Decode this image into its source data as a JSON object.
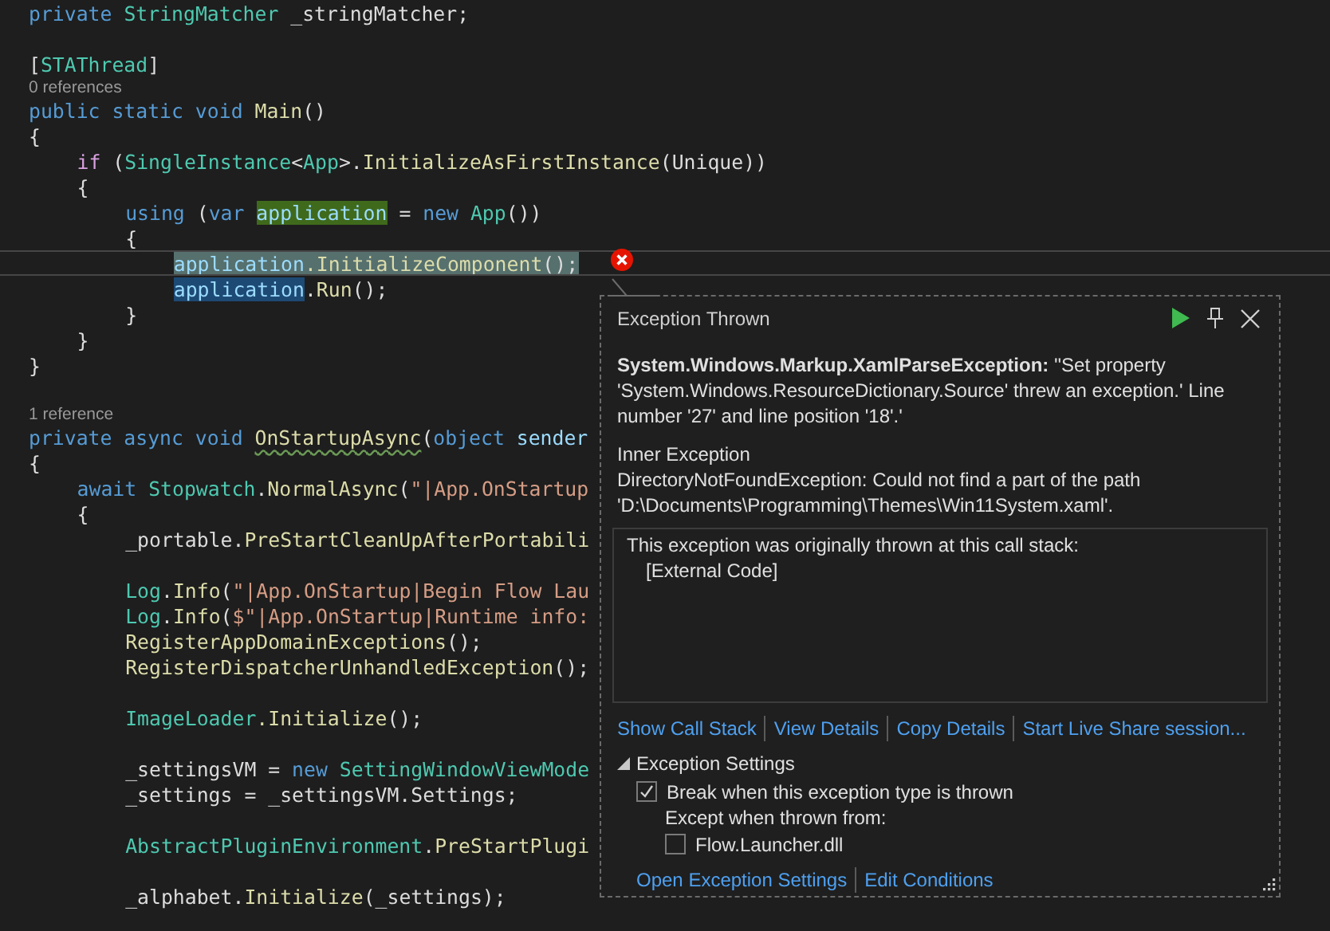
{
  "editor": {
    "lines": [
      {
        "kind": "code",
        "current": false,
        "tokens": [
          {
            "text": "private ",
            "kind": "keyword"
          },
          {
            "text": "StringMatcher",
            "kind": "type"
          },
          {
            "text": " _stringMatcher;",
            "kind": "plain"
          }
        ]
      },
      {
        "kind": "blank"
      },
      {
        "kind": "code",
        "current": false,
        "tokens": [
          {
            "text": "[",
            "kind": "plain"
          },
          {
            "text": "STAThread",
            "kind": "type"
          },
          {
            "text": "]",
            "kind": "plain"
          }
        ]
      },
      {
        "kind": "codelens",
        "text": "0 references"
      },
      {
        "kind": "code",
        "current": false,
        "tokens": [
          {
            "text": "public static void ",
            "kind": "keyword"
          },
          {
            "text": "Main",
            "kind": "method"
          },
          {
            "text": "()",
            "kind": "plain"
          }
        ]
      },
      {
        "kind": "code",
        "current": false,
        "tokens": [
          {
            "text": "{",
            "kind": "plain"
          }
        ]
      },
      {
        "kind": "block",
        "children": [
          {
            "kind": "code",
            "current": false,
            "tokens": [
              {
                "text": "if",
                "kind": "control"
              },
              {
                "text": " (",
                "kind": "plain"
              },
              {
                "text": "SingleInstance",
                "kind": "type"
              },
              {
                "text": "<",
                "kind": "plain"
              },
              {
                "text": "App",
                "kind": "type"
              },
              {
                "text": ">.",
                "kind": "plain"
              },
              {
                "text": "InitializeAsFirstInstance",
                "kind": "method"
              },
              {
                "text": "(Unique))",
                "kind": "plain"
              }
            ]
          },
          {
            "kind": "code",
            "current": false,
            "tokens": [
              {
                "text": "{",
                "kind": "plain"
              }
            ]
          },
          {
            "kind": "block",
            "children": [
              {
                "kind": "code",
                "current": false,
                "tokens": [
                  {
                    "text": "using",
                    "kind": "keyword"
                  },
                  {
                    "text": " (",
                    "kind": "plain"
                  },
                  {
                    "text": "var ",
                    "kind": "keyword"
                  },
                  {
                    "text": "application",
                    "kind": "variable_write"
                  },
                  {
                    "text": " = ",
                    "kind": "plain"
                  },
                  {
                    "text": "new ",
                    "kind": "keyword"
                  },
                  {
                    "text": "App",
                    "kind": "type"
                  },
                  {
                    "text": "())",
                    "kind": "plain"
                  }
                ]
              },
              {
                "kind": "code",
                "current": false,
                "tokens": [
                  {
                    "text": "{",
                    "kind": "plain"
                  }
                ]
              },
              {
                "kind": "block",
                "children": [
                  {
                    "kind": "code",
                    "current": true,
                    "tokens": [
                      {
                        "text": "application",
                        "kind": "variable"
                      },
                      {
                        "text": ".InitializeComponent",
                        "kind": "method"
                      },
                      {
                        "text": "();",
                        "kind": "plain"
                      }
                    ]
                  },
                  {
                    "kind": "code",
                    "current": false,
                    "tokens": [
                      {
                        "text": "application",
                        "kind": "variable_read"
                      },
                      {
                        "text": ".",
                        "kind": "plain"
                      },
                      {
                        "text": "Run",
                        "kind": "method"
                      },
                      {
                        "text": "();",
                        "kind": "plain"
                      }
                    ]
                  }
                ]
              },
              {
                "kind": "code",
                "current": false,
                "tokens": [
                  {
                    "text": "}",
                    "kind": "plain"
                  }
                ]
              }
            ]
          },
          {
            "kind": "code",
            "current": false,
            "tokens": [
              {
                "text": "}",
                "kind": "plain"
              }
            ]
          }
        ]
      },
      {
        "kind": "code",
        "current": false,
        "tokens": [
          {
            "text": "}",
            "kind": "plain"
          }
        ]
      },
      {
        "kind": "blank"
      },
      {
        "kind": "codelens",
        "text": "1 reference"
      },
      {
        "kind": "code",
        "current": false,
        "tokens": [
          {
            "text": "private async void ",
            "kind": "keyword"
          },
          {
            "text": "OnStartupAsync",
            "kind": "method_warning"
          },
          {
            "text": "(",
            "kind": "plain"
          },
          {
            "text": "object ",
            "kind": "keyword"
          },
          {
            "text": "sender",
            "kind": "variable"
          }
        ]
      },
      {
        "kind": "code",
        "current": false,
        "tokens": [
          {
            "text": "{",
            "kind": "plain"
          }
        ]
      },
      {
        "kind": "block",
        "children": [
          {
            "kind": "code",
            "current": false,
            "tokens": [
              {
                "text": "await ",
                "kind": "keyword"
              },
              {
                "text": "Stopwatch",
                "kind": "type"
              },
              {
                "text": ".",
                "kind": "plain"
              },
              {
                "text": "NormalAsync",
                "kind": "method"
              },
              {
                "text": "(",
                "kind": "plain"
              },
              {
                "text": "\"|App.OnStartup",
                "kind": "string"
              }
            ]
          },
          {
            "kind": "code",
            "current": false,
            "tokens": [
              {
                "text": "{",
                "kind": "plain"
              }
            ]
          },
          {
            "kind": "block",
            "children": [
              {
                "kind": "code",
                "current": false,
                "tokens": [
                  {
                    "text": "_portable.",
                    "kind": "plain"
                  },
                  {
                    "text": "PreStartCleanUpAfterPortabili",
                    "kind": "method"
                  }
                ]
              },
              {
                "kind": "blank"
              },
              {
                "kind": "code",
                "current": false,
                "tokens": [
                  {
                    "text": "Log",
                    "kind": "type"
                  },
                  {
                    "text": ".",
                    "kind": "plain"
                  },
                  {
                    "text": "Info",
                    "kind": "method"
                  },
                  {
                    "text": "(",
                    "kind": "plain"
                  },
                  {
                    "text": "\"|App.OnStartup|Begin Flow Lau",
                    "kind": "string"
                  }
                ]
              },
              {
                "kind": "code",
                "current": false,
                "tokens": [
                  {
                    "text": "Log",
                    "kind": "type"
                  },
                  {
                    "text": ".",
                    "kind": "plain"
                  },
                  {
                    "text": "Info",
                    "kind": "method"
                  },
                  {
                    "text": "(",
                    "kind": "plain"
                  },
                  {
                    "text": "$\"|App.OnStartup|Runtime info:",
                    "kind": "string"
                  }
                ]
              },
              {
                "kind": "code",
                "current": false,
                "tokens": [
                  {
                    "text": "RegisterAppDomainExceptions",
                    "kind": "method"
                  },
                  {
                    "text": "();",
                    "kind": "plain"
                  }
                ]
              },
              {
                "kind": "code",
                "current": false,
                "tokens": [
                  {
                    "text": "RegisterDispatcherUnhandledException",
                    "kind": "method"
                  },
                  {
                    "text": "();",
                    "kind": "plain"
                  }
                ]
              },
              {
                "kind": "blank"
              },
              {
                "kind": "code",
                "current": false,
                "tokens": [
                  {
                    "text": "ImageLoader",
                    "kind": "type"
                  },
                  {
                    "text": ".Initialize",
                    "kind": "method"
                  },
                  {
                    "text": "();",
                    "kind": "plain"
                  }
                ]
              },
              {
                "kind": "blank"
              },
              {
                "kind": "code",
                "current": false,
                "tokens": [
                  {
                    "text": "_settingsVM = ",
                    "kind": "plain"
                  },
                  {
                    "text": "new ",
                    "kind": "keyword"
                  },
                  {
                    "text": "SettingWindowViewMode",
                    "kind": "type"
                  }
                ]
              },
              {
                "kind": "code",
                "current": false,
                "tokens": [
                  {
                    "text": "_settings = _settingsVM.Settings;",
                    "kind": "plain"
                  }
                ]
              },
              {
                "kind": "blank"
              },
              {
                "kind": "code",
                "current": false,
                "tokens": [
                  {
                    "text": "AbstractPluginEnvironment",
                    "kind": "type"
                  },
                  {
                    "text": ".",
                    "kind": "plain"
                  },
                  {
                    "text": "PreStartPlugi",
                    "kind": "method"
                  }
                ]
              },
              {
                "kind": "blank"
              },
              {
                "kind": "code",
                "current": false,
                "tokens": [
                  {
                    "text": "_alphabet.",
                    "kind": "plain"
                  },
                  {
                    "text": "Initialize",
                    "kind": "method"
                  },
                  {
                    "text": "(_settings);",
                    "kind": "plain"
                  }
                ]
              }
            ]
          }
        ]
      }
    ]
  },
  "exception_popup": {
    "title": "Exception Thrown",
    "message": "**System.Windows.Markup.XamlParseException:** ''Set property 'System.Windows.ResourceDictionary.Source' threw an exception.' Line number '27' and line position '18'.'",
    "inner_exception_label": "Inner Exception",
    "inner_exception": "DirectoryNotFoundException: Could not find a part of the path 'D:\\Documents\\Programming\\Themes\\Win11System.xaml'.",
    "call_stack": {
      "heading": "This exception was originally thrown at this call stack:",
      "frames": [
        "[External Code]"
      ]
    },
    "links": [
      "Show Call Stack",
      "View Details",
      "Copy Details",
      "Start Live Share session..."
    ],
    "settings": {
      "title": "Exception Settings",
      "expanded": true,
      "break_option": {
        "label": "Break when this exception type is thrown",
        "checked": true
      },
      "except_label": "Except when thrown from:",
      "modules": [
        {
          "label": "Flow.Launcher.dll",
          "checked": false
        }
      ]
    },
    "footer_links": [
      "Open Exception Settings",
      "Edit Conditions"
    ]
  }
}
